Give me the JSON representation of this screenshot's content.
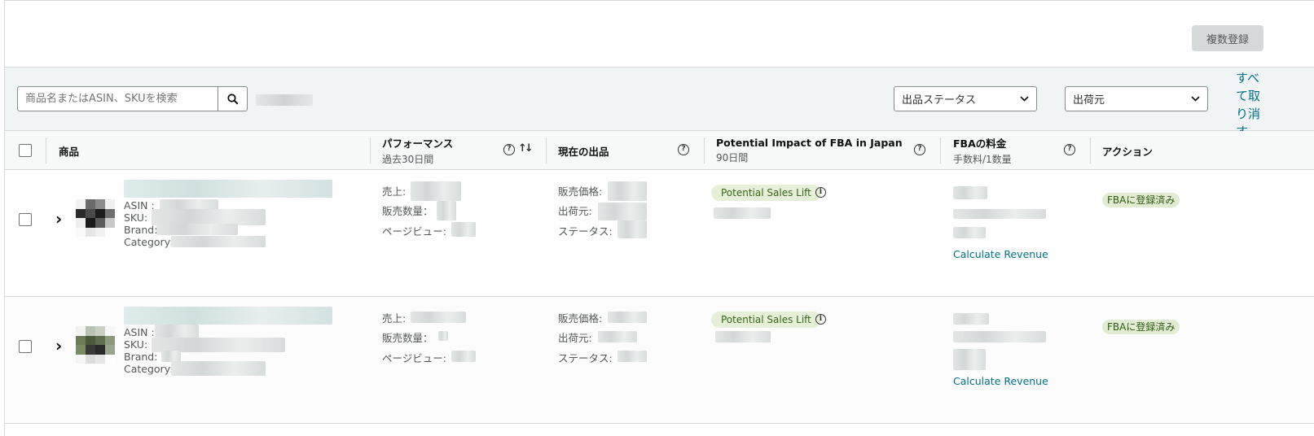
{
  "toolbar": {
    "multi_register_label": "複数登録"
  },
  "filters": {
    "search_placeholder": "商品名またはASIN、SKUを検索",
    "status_select": "出品ステータス",
    "ship_select": "出荷元",
    "clear_all": "すべて取り消す"
  },
  "table": {
    "headers": {
      "product": "商品",
      "performance": "パフォーマンス",
      "performance_sub": "過去30日間",
      "current_listing": "現在の出品",
      "impact": "Potential Impact of FBA in Japan",
      "impact_sub": "90日間",
      "fees": "FBAの料金",
      "fees_sub": "手数料/1数量",
      "action": "アクション"
    },
    "labels": {
      "asin": "ASIN :",
      "sku": "SKU:",
      "brand": "Brand:",
      "category": "Category:",
      "sales": "売上:",
      "units": "販売数量：",
      "pageviews": "ページビュー:",
      "price": "販売価格:",
      "ship_from": "出荷元:",
      "status": "ステータス:",
      "sales_lift": "Potential Sales Lift",
      "calc_revenue": "Calculate Revenue",
      "fba_registered": "FBAに登録済み"
    }
  },
  "colors": {
    "link": "#007185",
    "pill_bg": "#e6f0d9",
    "pill_text": "#37651a"
  }
}
